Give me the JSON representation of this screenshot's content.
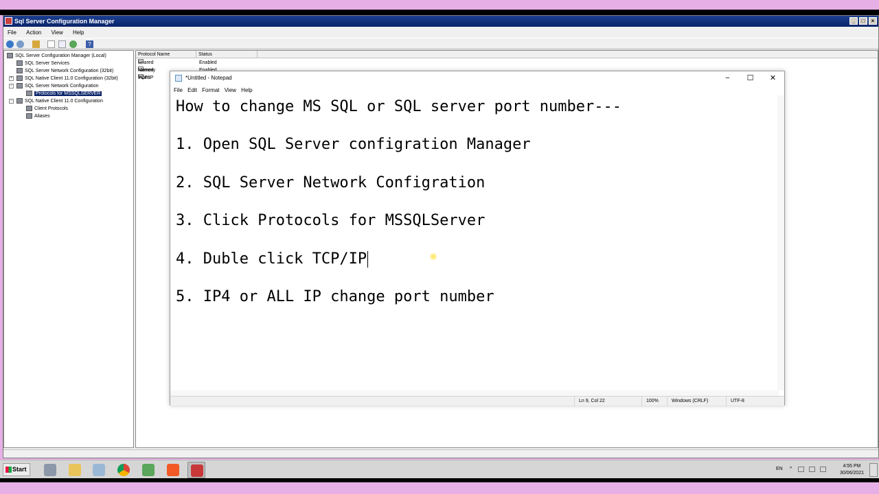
{
  "scm": {
    "title": "Sql Server Configuration Manager",
    "menu": [
      "File",
      "Action",
      "View",
      "Help"
    ],
    "tree": [
      {
        "label": "SQL Server Configuration Manager (Local)"
      },
      {
        "label": "SQL Server Services"
      },
      {
        "label": "SQL Server Network Configuration (32bit)"
      },
      {
        "label": "SQL Native Client 11.0 Configuration (32bit)"
      },
      {
        "label": "SQL Server Network Configuration"
      },
      {
        "label": "Protocols for MSSQLSERVER"
      },
      {
        "label": "SQL Native Client 11.0 Configuration"
      },
      {
        "label": "Client Protocols"
      },
      {
        "label": "Aliases"
      }
    ],
    "columns": [
      "Protocol Name",
      "Status"
    ],
    "rows": [
      {
        "name": "Shared Memory",
        "status": "Enabled"
      },
      {
        "name": "Named Pipes",
        "status": "Enabled"
      },
      {
        "name": "TCP/IP",
        "status": ""
      }
    ]
  },
  "notepad": {
    "title": "*Untitled - Notepad",
    "menu": [
      "File",
      "Edit",
      "Format",
      "View",
      "Help"
    ],
    "lines": [
      "How to change MS SQL or SQL server port number---",
      "1. Open SQL Server configration Manager",
      "2. SQL Server Network Configration",
      "3. Click Protocols for MSSQLServer",
      "4. Duble click TCP/IP",
      "5. IP4 or ALL IP change port number"
    ],
    "status": {
      "position": "Ln 9, Col 22",
      "zoom": "100%",
      "line_ending": "Windows (CRLF)",
      "encoding": "UTF-8"
    }
  },
  "taskbar": {
    "start_label": "Start",
    "language": "EN",
    "time": "4:55 PM",
    "date": "30/06/2021"
  }
}
